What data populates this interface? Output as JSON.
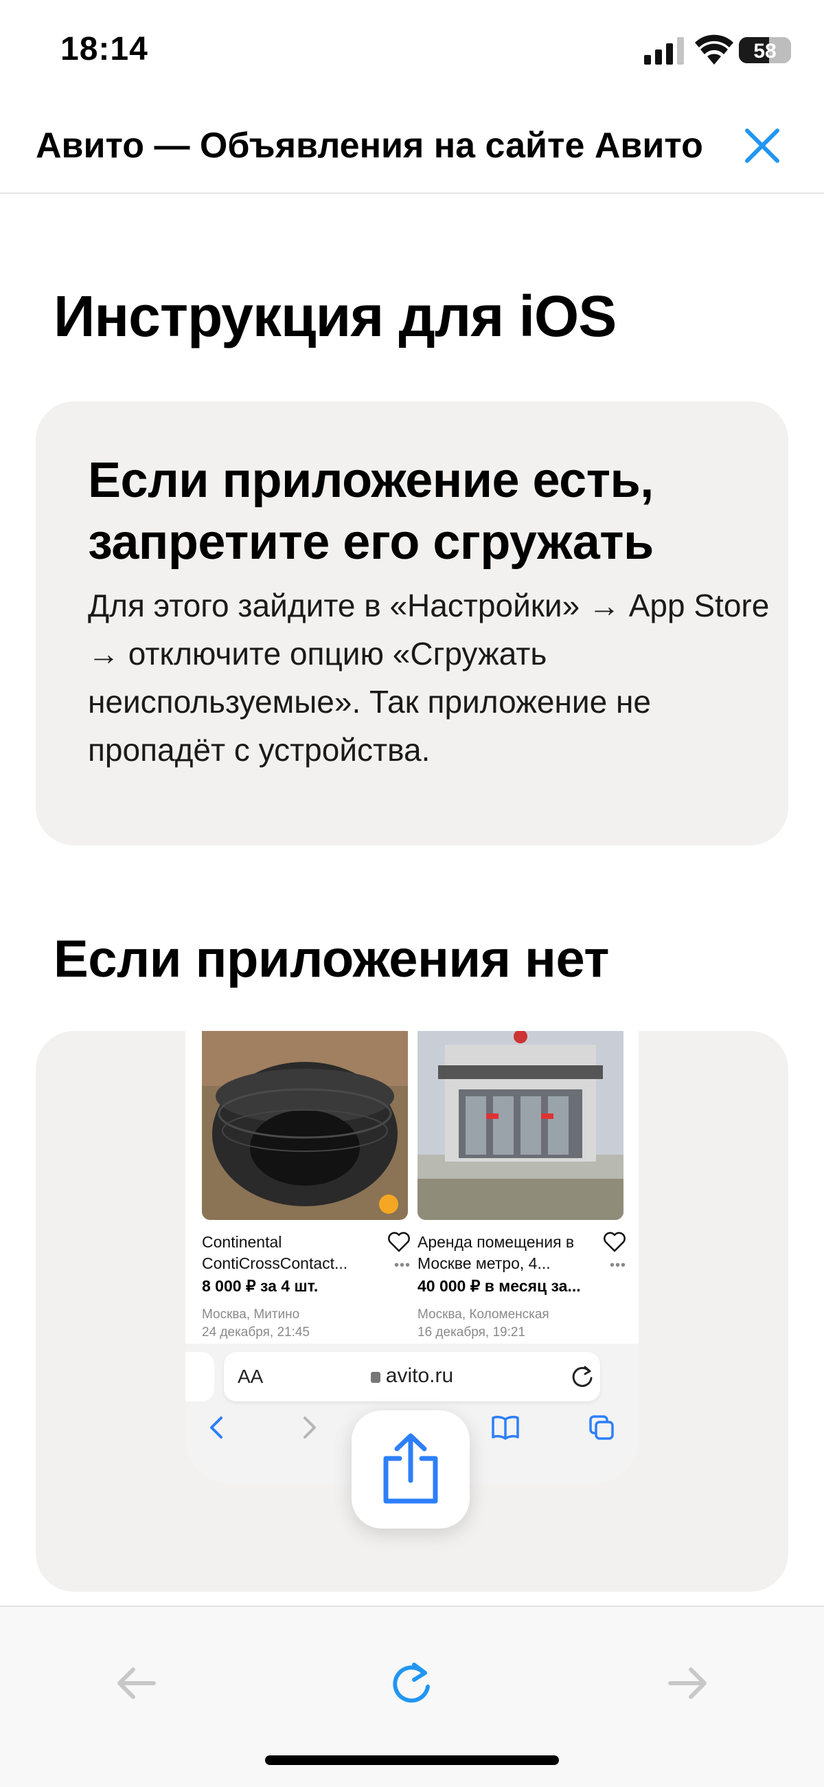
{
  "status_bar": {
    "time": "18:14",
    "battery_level": 58,
    "battery_text": "58"
  },
  "header": {
    "title": "Авито — Объявления на сайте Авито",
    "close_icon": "close-icon"
  },
  "main": {
    "heading": "Инструкция для iOS",
    "card_offload": {
      "title": "Если приложение есть, запретите его сгружать",
      "text": "Для этого зайдите в «Настройки» → App Store → отключите опцию «Сгружать неиспользуемые». Так приложение не пропадёт с устройства."
    },
    "heading_no_app": "Если приложения нет",
    "illustration": {
      "listings": [
        {
          "title": "Continental ContiCrossContact...",
          "price": "8 000 ₽ за 4 шт.",
          "location": "Москва, Митино",
          "date": "24 декабря, 21:45"
        },
        {
          "title": "Аренда помещения в Москве метро, 4...",
          "price": "40 000 ₽ в месяц за...",
          "location": "Москва, Коломенская",
          "date": "16 декабря, 19:21"
        }
      ],
      "safari": {
        "aa_label": "AA",
        "url": "avito.ru"
      },
      "share_icon": "share-icon"
    }
  },
  "toolbar": {
    "back_icon": "arrow-left-icon",
    "reload_icon": "reload-icon",
    "forward_icon": "arrow-right-icon"
  },
  "colors": {
    "accent": "#2196f3",
    "card_bg": "#f2f1f0",
    "safari_blue": "#2d7ff9"
  }
}
